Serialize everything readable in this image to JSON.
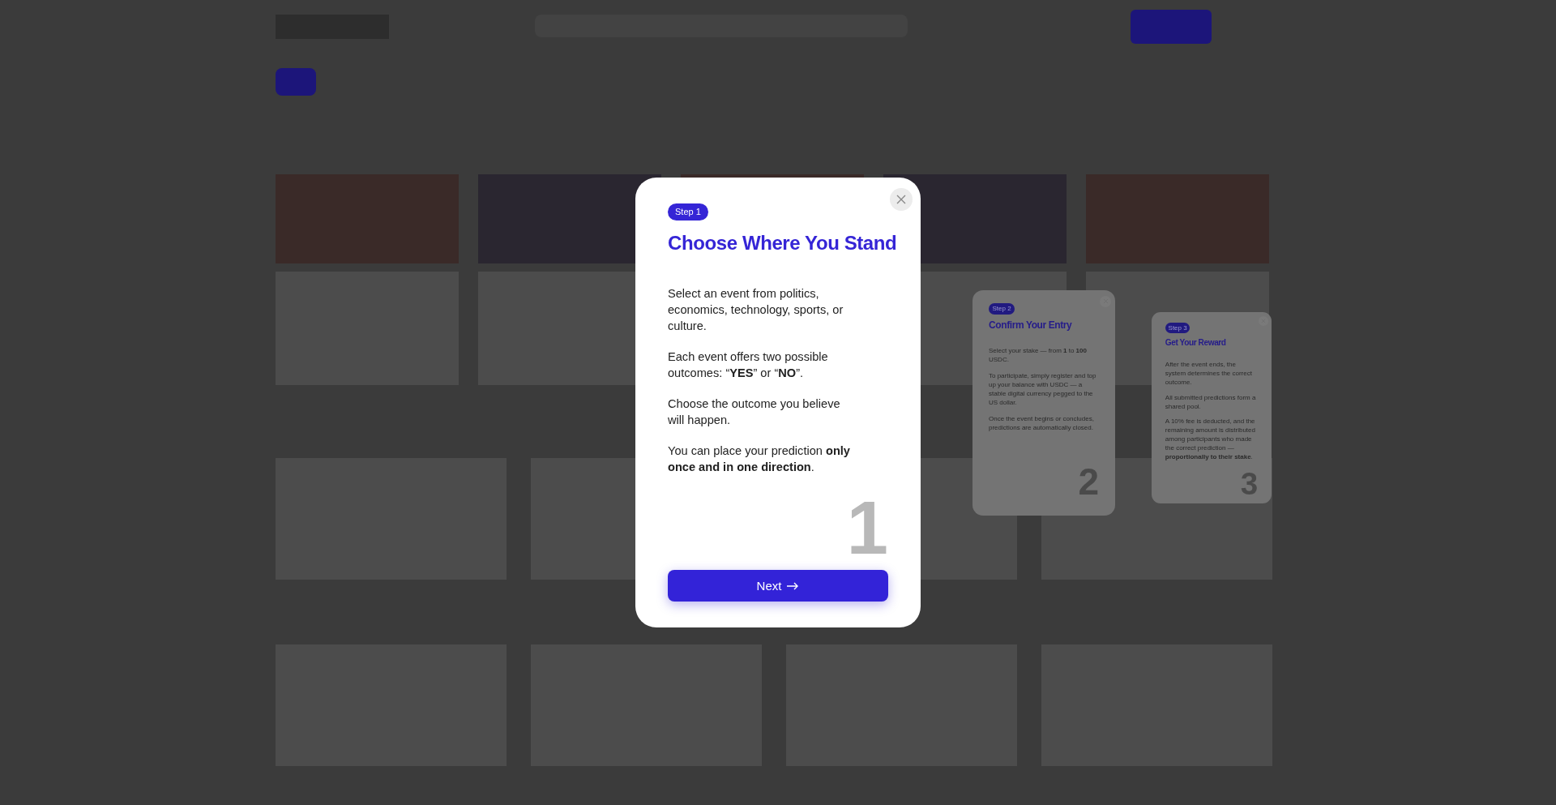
{
  "steps": [
    {
      "badge": "Step 1",
      "title": "Choose Where You Stand",
      "numeral": "1",
      "active": true,
      "paragraphs": [
        "Select an event from politics, economics, technology, sports, or culture.",
        "Each event offers two possible outcomes: “**YES**” or “**NO**”.",
        "Choose the outcome you believe will happen.",
        "You can place your prediction **only once and in one direction**."
      ]
    },
    {
      "badge": "Step 2",
      "title": "Confirm Your Entry",
      "numeral": "2",
      "active": false,
      "paragraphs": [
        "Select your stake — from **1** to **100** USDC.",
        "To participate, simply register and top up your balance with USDC — a stable digital currency pegged to the US dollar.",
        "Once the event begins or concludes, predictions are automatically closed."
      ]
    },
    {
      "badge": "Step 3",
      "title": "Get Your Reward",
      "numeral": "3",
      "active": false,
      "paragraphs": [
        "After the event ends, the system determines the correct outcome.",
        "All submitted predictions form a shared pool.",
        "A 10% fee is deducted, and the remaining amount is distributed among participants who made the correct prediction — **proportionally to their stake**."
      ]
    }
  ],
  "next_button": {
    "label": "Next"
  }
}
